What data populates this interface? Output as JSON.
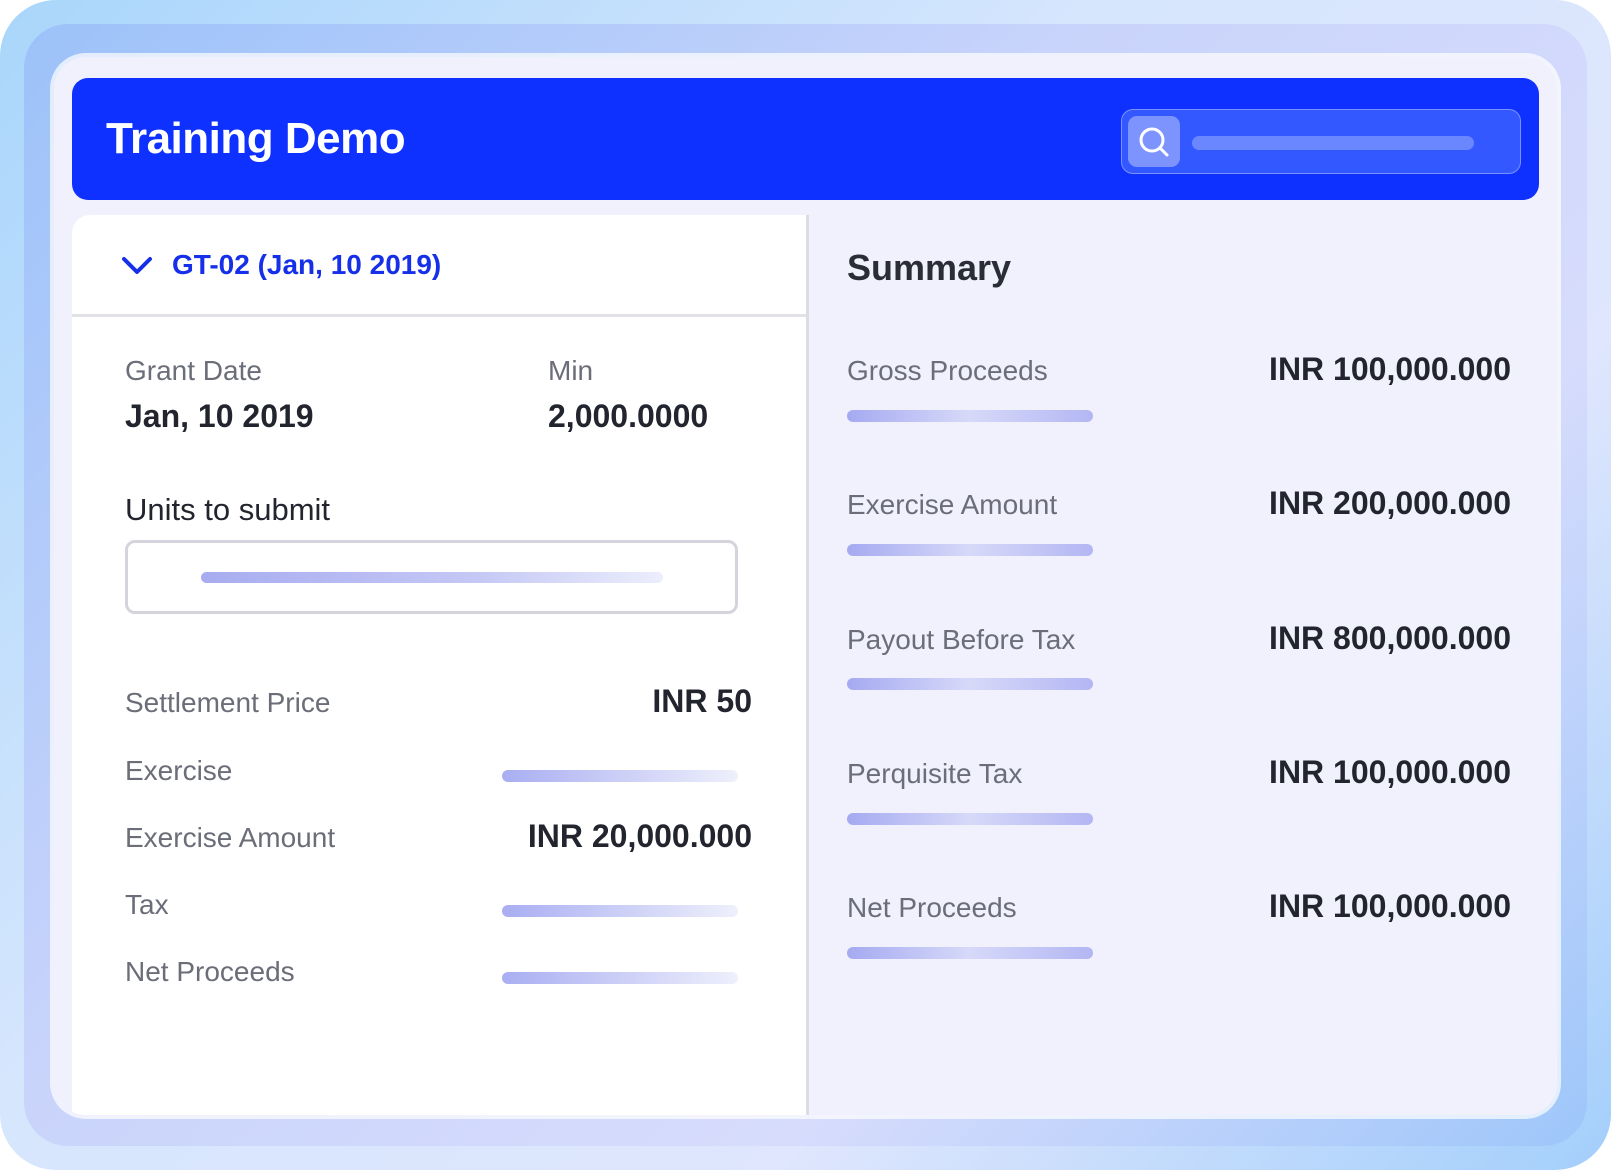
{
  "app": {
    "title": "Training Demo"
  },
  "search": {
    "icon": "search-icon"
  },
  "grant": {
    "label": "GT-02 (Jan, 10 2019)",
    "icon": "chevron-down-icon",
    "fields": {
      "grant_date_label": "Grant Date",
      "grant_date_value": "Jan, 10 2019",
      "min_label": "Min",
      "min_value": "2,000.0000"
    },
    "units_label": "Units to submit",
    "rows": {
      "settlement_price_label": "Settlement Price",
      "settlement_price_value": "INR 50",
      "exercise_label": "Exercise",
      "exercise_amount_label": "Exercise Amount",
      "exercise_amount_value": "INR 20,000.000",
      "tax_label": "Tax",
      "net_proceeds_label": "Net Proceeds"
    }
  },
  "summary": {
    "title": "Summary",
    "items": [
      {
        "label": "Gross Proceeds",
        "value": "INR 100,000.000"
      },
      {
        "label": "Exercise Amount",
        "value": "INR 200,000.000"
      },
      {
        "label": "Payout Before Tax",
        "value": "INR 800,000.000"
      },
      {
        "label": "Perquisite Tax",
        "value": "INR 100,000.000"
      },
      {
        "label": "Net Proceeds",
        "value": "INR 100,000.000"
      }
    ]
  },
  "colors": {
    "brand_blue": "#0f31ff",
    "grant_link": "#1530e8",
    "placeholder_bar": "#a7acf0"
  }
}
